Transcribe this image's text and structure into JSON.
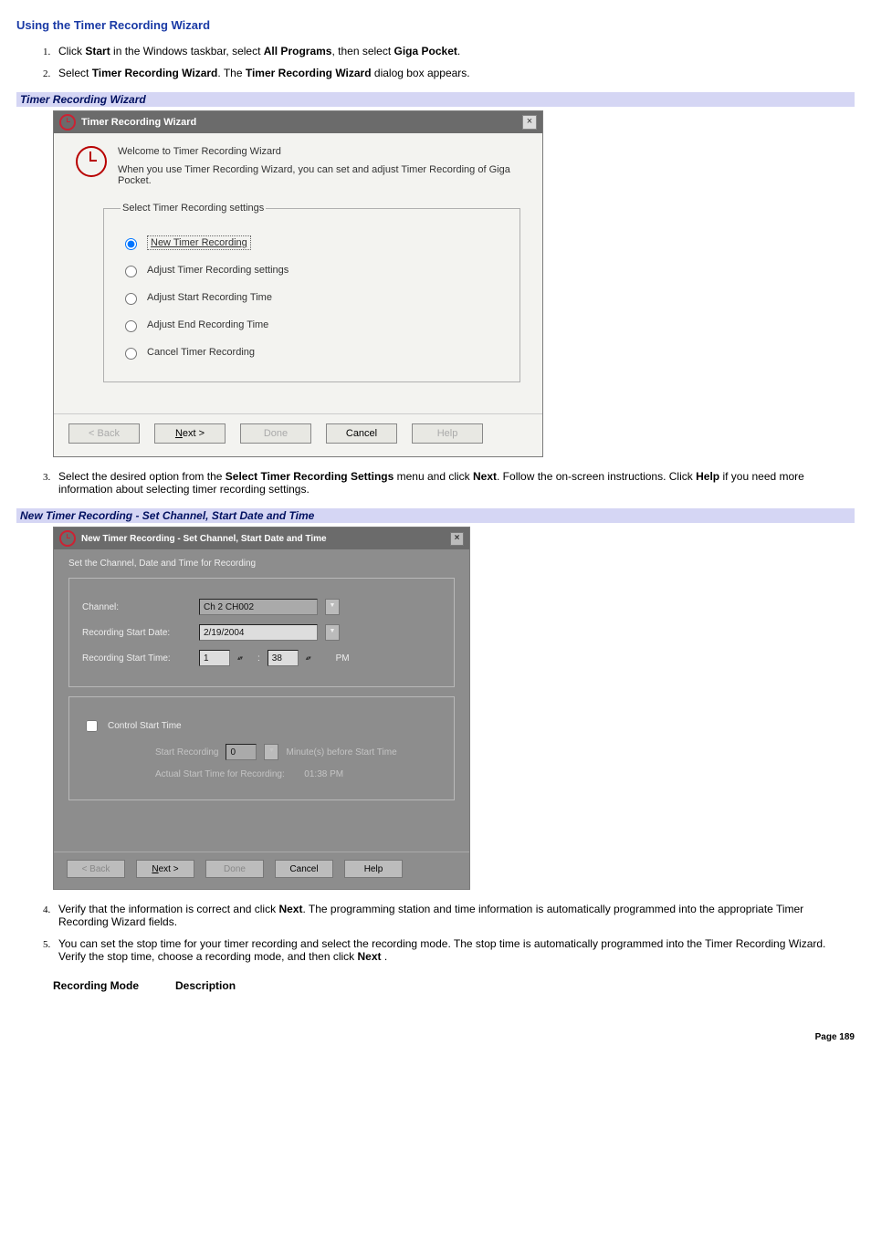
{
  "heading": "Using the Timer Recording Wizard",
  "steps": {
    "s1_a": "Click ",
    "s1_b": "Start",
    "s1_c": " in the Windows taskbar, select ",
    "s1_d": "All Programs",
    "s1_e": ", then select ",
    "s1_f": "Giga Pocket",
    "s1_g": ".",
    "s2_a": "Select ",
    "s2_b": "Timer Recording Wizard",
    "s2_c": ". The ",
    "s2_d": "Timer Recording Wizard",
    "s2_e": " dialog box appears.",
    "s3_a": "Select the desired option from the ",
    "s3_b": "Select Timer Recording Settings",
    "s3_c": " menu and click ",
    "s3_d": "Next",
    "s3_e": ". Follow the on-screen instructions. Click ",
    "s3_f": "Help",
    "s3_g": " if you need more information about selecting timer recording settings.",
    "s4_a": "Verify that the information is correct and click ",
    "s4_b": "Next",
    "s4_c": ". The programming station and time information is automatically programmed into the appropriate Timer Recording Wizard fields.",
    "s5_a": "You can set the stop time for your timer recording and select the recording mode. The stop time is automatically programmed into the Timer Recording Wizard. Verify the stop time, choose a recording mode, and then click ",
    "s5_b": "Next ",
    "s5_c": "."
  },
  "caption1": "Timer Recording Wizard",
  "dialog1": {
    "title": "Timer Recording Wizard",
    "intro1": "Welcome to Timer Recording Wizard",
    "intro2": "When you use Timer Recording Wizard, you can set and adjust Timer Recording of Giga Pocket.",
    "legend": "Select Timer Recording settings",
    "opt1": "New Timer Recording",
    "opt2": "Adjust Timer Recording settings",
    "opt3": "Adjust Start Recording Time",
    "opt4": "Adjust End Recording Time",
    "opt5": "Cancel Timer Recording",
    "back": "< Back",
    "next": "Next >",
    "done": "Done",
    "cancel": "Cancel",
    "help": "Help"
  },
  "caption2": "New Timer Recording - Set Channel, Start Date and Time",
  "dialog2": {
    "title": "New Timer Recording - Set Channel, Start Date and Time",
    "subtitle": "Set the Channel, Date and Time for Recording",
    "channel_lbl": "Channel:",
    "channel_val": "Ch 2 CH002",
    "date_lbl": "Recording Start Date:",
    "date_val": "2/19/2004",
    "time_lbl": "Recording Start Time:",
    "time_h": "1",
    "time_m": "38",
    "time_ampm": "PM",
    "cst_lbl": "Control Start Time",
    "sr_lbl": "Start Recording",
    "sr_val": "0",
    "sr_suffix": "Minute(s) before Start Time",
    "actual_lbl": "Actual Start Time for Recording:",
    "actual_val": "01:38 PM",
    "back": "< Back",
    "next": "Next >",
    "done": "Done",
    "cancel": "Cancel",
    "help": "Help"
  },
  "table": {
    "col1": "Recording Mode",
    "col2": "Description"
  },
  "page": "Page 189"
}
